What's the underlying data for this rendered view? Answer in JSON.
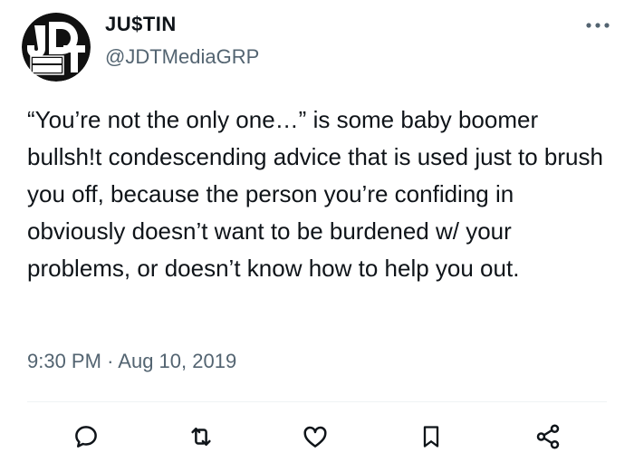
{
  "author": {
    "display_name": "JU$TIN",
    "handle": "@JDTMediaGRP",
    "avatar_icon": "jdt-media-grp-logo"
  },
  "tweet": {
    "text": "“You’re not the only one…” is some baby boomer bullsh!t condescending advice that is used just to brush you off, because the person you’re confiding in obviously doesn’t want to be burdened w/ your problems, or doesn’t know how to help you out.",
    "time": "9:30 PM",
    "separator": "·",
    "date": "Aug 10, 2019"
  },
  "actions": [
    {
      "name": "reply",
      "icon": "reply-icon"
    },
    {
      "name": "retweet",
      "icon": "retweet-icon"
    },
    {
      "name": "like",
      "icon": "heart-icon"
    },
    {
      "name": "bookmark",
      "icon": "bookmark-icon"
    },
    {
      "name": "share",
      "icon": "share-icon"
    }
  ],
  "colors": {
    "text_primary": "#0f1419",
    "text_secondary": "#536471",
    "divider": "#eff3f4",
    "icon": "#0f1419"
  }
}
